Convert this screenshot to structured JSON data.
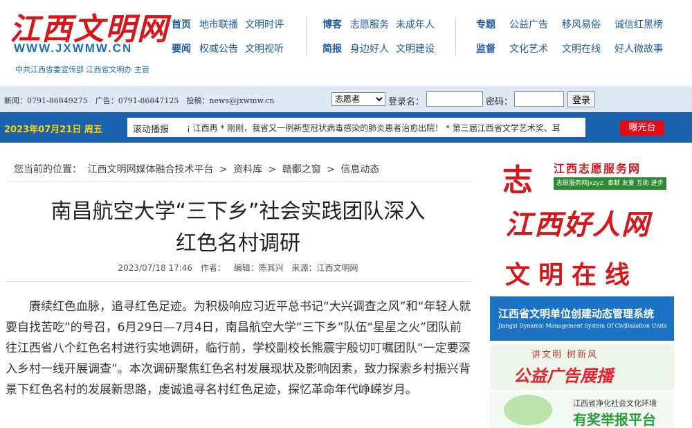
{
  "header": {
    "logo_cn": "江西文明网",
    "logo_en": "WWW.JXWMW.CN",
    "logo_sub": "中共江西省委宣传部 江西省文明办 主管",
    "nav": [
      {
        "rows": [
          {
            "cat": "首页",
            "links": [
              "地市联播",
              "文明时评"
            ]
          },
          {
            "cat": "要闻",
            "links": [
              "权威公告",
              "文明视听"
            ]
          }
        ]
      },
      {
        "rows": [
          {
            "cat": "博客",
            "links": [
              "志愿服务",
              "未成年人"
            ]
          },
          {
            "cat": "简报",
            "links": [
              "身边好人",
              "文明建设"
            ]
          }
        ]
      },
      {
        "rows": [
          {
            "cat": "专题",
            "links": [
              "公益广告",
              "移风易俗",
              "诚信红黑榜"
            ]
          },
          {
            "cat": "监督",
            "links": [
              "文化艺术",
              "文明在线",
              "好人微故事"
            ]
          }
        ]
      }
    ]
  },
  "loginbar": {
    "info": "新闻：0791-86849275　广告：0791-86847125　投稿：news@jxwmw.cn",
    "role_selected": "志愿者",
    "login_label": "登录名：",
    "password_label": "密码：",
    "login_button": "登录"
  },
  "datebar": {
    "date": "2023年07月21日 周五",
    "ticker_label": "滚动播报",
    "ticker_text": "¡ 江西再 * 刚刚，我省又一例新型冠状病毒感染的肺炎患者治愈出院！ * 第三届江西省文学艺术奖、耳",
    "expose_button": "曝光台"
  },
  "breadcrumb": [
    "您当前的位置：",
    "江西文明网媒体融合技术平台",
    ">",
    "资料库",
    ">",
    "赣鄱之窗",
    ">",
    "信息动态"
  ],
  "article": {
    "title_line1": "南昌航空大学“三下乡”社会实践团队深入",
    "title_line2": "红色名村调研",
    "date": "2023/07/18 17:46",
    "author_label": "作者：",
    "editor": "编辑：陈其兴",
    "source": "来源：江西文明网",
    "body": "赓续红色血脉，追寻红色足迹。为积极响应习近平总书记“大兴调查之风”和“年轻人就要自找苦吃”的号召，6月29日—7月4日，南昌航空大学“三下乡”队伍“星星之火”团队前往江西省八个红色名村进行实地调研，临行前，学校副校长熊震宇殷切叮嘱团队“一定要深入乡村一线开展调查”。本次调研聚焦红色名村发展现状及影响因素，致力探索乡村振兴背景下红色名村的发展新思路，虔诚追寻名村红色足迹，探忆革命年代峥嵘岁月。"
  },
  "sidebar": {
    "volunteer": {
      "mark": "志",
      "title": "江西志愿服务网",
      "url": "志愿服务网jxzyz.cn",
      "tags": "奉献 友爱 互助 进步"
    },
    "good_people": {
      "title": "江西好人网"
    },
    "civil_online": {
      "title": "文明在线"
    },
    "dynamic": {
      "title": "江西省文明单位创建动态管理系统",
      "subtitle": "Jiangxi Dynamic Management System Of Civiliazation Units"
    },
    "public_ad": {
      "slogan": "讲文明 树新风",
      "title": "公益广告展播"
    },
    "report": {
      "subtitle": "江西省净化社会文化环境",
      "title": "有奖举报平台"
    }
  },
  "colors": {
    "brand_red": "#d7161a",
    "nav_blue": "#1d5aa5",
    "date_bar": "#1a62ad",
    "date_text": "#ffd200"
  }
}
